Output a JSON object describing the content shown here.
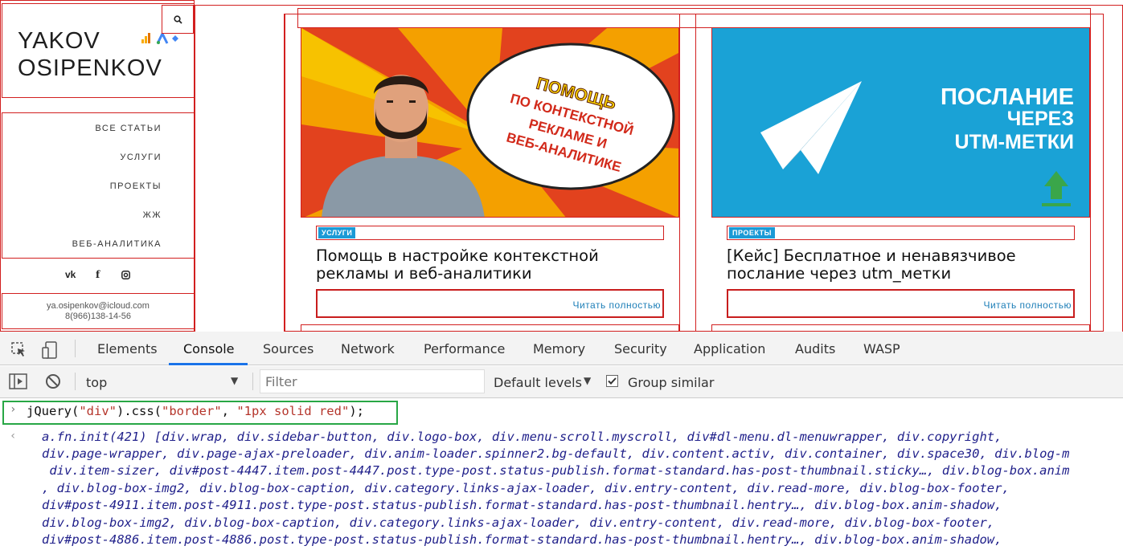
{
  "site": {
    "logo": {
      "line1": "YAKOV",
      "line2": "OSIPENKOV"
    },
    "menu": [
      "ВСЕ СТАТЬИ",
      "УСЛУГИ",
      "ПРОЕКТЫ",
      "ЖЖ",
      "ВЕБ-АНАЛИТИКА"
    ],
    "social": [
      "vk-icon",
      "facebook-icon",
      "instagram-icon"
    ],
    "contact": {
      "email": "ya.osipenkov@icloud.com",
      "phone": "8(966)138-14-56"
    },
    "posts": [
      {
        "category": "УСЛУГИ",
        "title": "Помощь в настройке контекстной рекламы и веб-аналитики",
        "image_caption": "Помощь по контекстной рекламе и веб-аналитике",
        "read_more": "Читать полностью"
      },
      {
        "category": "ПРОЕКТЫ",
        "title": "[Кейс] Бесплатное и ненавязчивое послание через utm_метки",
        "image_caption": {
          "line1": "ПОСЛАНИЕ",
          "line2": "ЧЕРЕЗ",
          "line3": "UTM-МЕТКИ"
        },
        "read_more": "Читать полностью"
      }
    ]
  },
  "devtools": {
    "tabs": [
      "Elements",
      "Console",
      "Sources",
      "Network",
      "Performance",
      "Memory",
      "Security",
      "Application",
      "Audits",
      "WASP"
    ],
    "active_tab": "Console",
    "context": "top",
    "filter_placeholder": "Filter",
    "levels": "Default levels",
    "group_similar": "Group similar",
    "command_parts": [
      "jQuery(",
      "\"div\"",
      ").css(",
      "\"border\"",
      ", ",
      "\"1px solid red\"",
      ");"
    ],
    "output_lines": [
      "a.fn.init(421) [div.wrap, div.sidebar-button, div.logo-box, div.menu-scroll.myscroll, div#dl-menu.dl-menuwrapper, div.copyright,",
      "div.page-wrapper, div.page-ajax-preloader, div.anim-loader.spinner2.bg-default, div.content.activ, div.container, div.space30, div.blog-m",
      " div.item-sizer, div#post-4447.item.post-4447.post.type-post.status-publish.format-standard.has-post-thumbnail.sticky…, div.blog-box.anim",
      ", div.blog-box-img2, div.blog-box-caption, div.category.links-ajax-loader, div.entry-content, div.read-more, div.blog-box-footer,",
      "div#post-4911.item.post-4911.post.type-post.status-publish.format-standard.has-post-thumbnail.hentry…, div.blog-box.anim-shadow,",
      "div.blog-box-img2, div.blog-box-caption, div.category.links-ajax-loader, div.entry-content, div.read-more, div.blog-box-footer,",
      "div#post-4886.item.post-4886.post.type-post.status-publish.format-standard.has-post-thumbnail.hentry…, div.blog-box.anim-shadow,"
    ]
  }
}
